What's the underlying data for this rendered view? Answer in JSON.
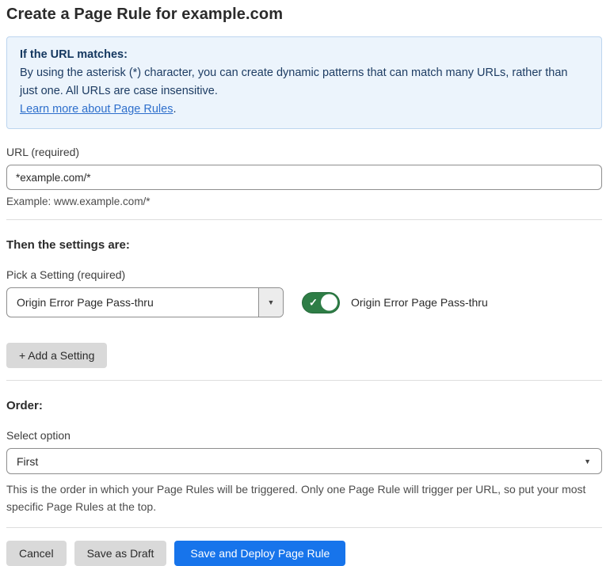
{
  "page": {
    "title": "Create a Page Rule for example.com"
  },
  "info_box": {
    "heading": "If the URL matches:",
    "body": "By using the asterisk (*) character, you can create dynamic patterns that can match many URLs, rather than just one. All URLs are case insensitive.",
    "link_label": "Learn more about Page Rules",
    "link_suffix": "."
  },
  "url_field": {
    "label": "URL (required)",
    "value": "*example.com/*",
    "helper": "Example: www.example.com/*"
  },
  "settings_section": {
    "heading": "Then the settings are:",
    "picker_label": "Pick a Setting (required)",
    "picker_value": "Origin Error Page Pass-thru",
    "toggle_state": "on",
    "toggle_label": "Origin Error Page Pass-thru",
    "add_setting_label": "+ Add a Setting"
  },
  "order_section": {
    "heading": "Order:",
    "select_label": "Select option",
    "select_value": "First",
    "helper": "This is the order in which your Page Rules will be triggered. Only one Page Rule will trigger per URL, so put your most specific Page Rules at the top."
  },
  "footer": {
    "cancel_label": "Cancel",
    "save_draft_label": "Save as Draft",
    "save_deploy_label": "Save and Deploy Page Rule"
  },
  "icons": {
    "toggle_check": "✓",
    "select_caret": "▼"
  },
  "colors": {
    "info_box_bg": "#ecf4fc",
    "info_box_border": "#bdd5ef",
    "info_text": "#1d3c63",
    "link_blue": "#2e6fcc",
    "toggle_green": "#2e7d46",
    "primary_button_blue": "#1774eb",
    "secondary_button_gray": "#d9d9d9",
    "divider_gray": "#dedede"
  }
}
